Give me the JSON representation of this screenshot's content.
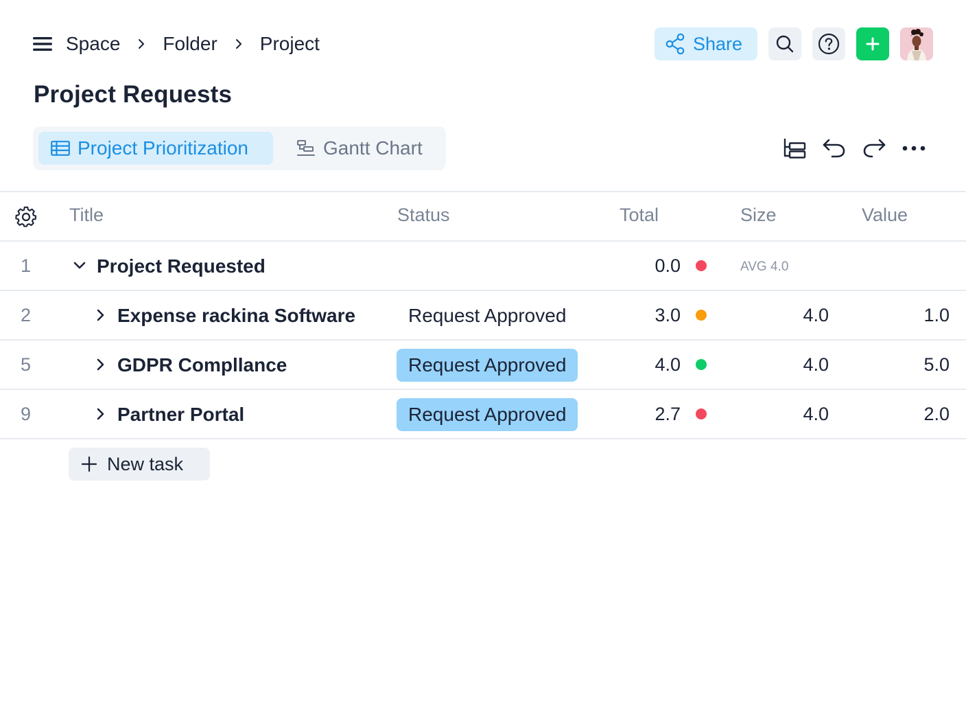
{
  "breadcrumb": {
    "items": [
      "Space",
      "Folder",
      "Project"
    ]
  },
  "header": {
    "share_label": "Share",
    "accent_color": "#1a8fe3",
    "add_color": "#0ccd66"
  },
  "page": {
    "title": "Project Requests"
  },
  "views": {
    "tabs": [
      {
        "label": "Project Prioritization",
        "active": true,
        "icon": "table-icon"
      },
      {
        "label": "Gantt Chart",
        "active": false,
        "icon": "gantt-icon"
      }
    ]
  },
  "table": {
    "columns": [
      "Title",
      "Status",
      "Total",
      "Size",
      "Value"
    ],
    "group": {
      "num": "1",
      "title": "Project Requested",
      "total": "0.0",
      "dot_color": "#f4485f",
      "avg_label": "AVG 4.0"
    },
    "rows": [
      {
        "num": "2",
        "title": "Expense rackina Software",
        "status": "Request Approved",
        "highlight": false,
        "total": "3.0",
        "dot_color": "#f99d0b",
        "size": "4.0",
        "value": "1.0"
      },
      {
        "num": "5",
        "title": "GDPR Compllance",
        "status": "Request Approved",
        "highlight": true,
        "total": "4.0",
        "dot_color": "#0ccd66",
        "size": "4.0",
        "value": "5.0"
      },
      {
        "num": "9",
        "title": "Partner Portal",
        "status": "Request Approved",
        "highlight": true,
        "total": "2.7",
        "dot_color": "#f4485f",
        "size": "4.0",
        "value": "2.0"
      }
    ],
    "new_task_label": "New task"
  }
}
